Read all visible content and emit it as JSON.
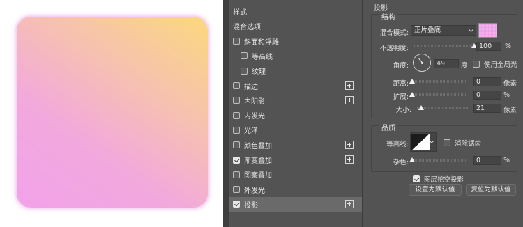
{
  "style_list": {
    "items": [
      {
        "label": "样式",
        "checkbox": false,
        "checked": false,
        "plus": false,
        "selected": false,
        "indent": 0
      },
      {
        "label": "混合选项",
        "checkbox": false,
        "checked": false,
        "plus": false,
        "selected": false,
        "indent": 0
      },
      {
        "label": "斜面和浮雕",
        "checkbox": true,
        "checked": false,
        "plus": false,
        "selected": false,
        "indent": 0
      },
      {
        "label": "等高线",
        "checkbox": true,
        "checked": false,
        "plus": false,
        "selected": false,
        "indent": 1
      },
      {
        "label": "纹理",
        "checkbox": true,
        "checked": false,
        "plus": false,
        "selected": false,
        "indent": 1
      },
      {
        "label": "描边",
        "checkbox": true,
        "checked": false,
        "plus": true,
        "selected": false,
        "indent": 0
      },
      {
        "label": "内阴影",
        "checkbox": true,
        "checked": false,
        "plus": true,
        "selected": false,
        "indent": 0
      },
      {
        "label": "内发光",
        "checkbox": true,
        "checked": false,
        "plus": false,
        "selected": false,
        "indent": 0
      },
      {
        "label": "光泽",
        "checkbox": true,
        "checked": false,
        "plus": false,
        "selected": false,
        "indent": 0
      },
      {
        "label": "颜色叠加",
        "checkbox": true,
        "checked": false,
        "plus": true,
        "selected": false,
        "indent": 0
      },
      {
        "label": "渐变叠加",
        "checkbox": true,
        "checked": true,
        "plus": true,
        "selected": false,
        "indent": 0
      },
      {
        "label": "图案叠加",
        "checkbox": true,
        "checked": false,
        "plus": false,
        "selected": false,
        "indent": 0
      },
      {
        "label": "外发光",
        "checkbox": true,
        "checked": false,
        "plus": false,
        "selected": false,
        "indent": 0
      },
      {
        "label": "投影",
        "checkbox": true,
        "checked": true,
        "plus": true,
        "selected": true,
        "indent": 0
      }
    ]
  },
  "drop_shadow": {
    "title": "投影",
    "structure": {
      "title": "结构",
      "blend_mode_label": "混合模式:",
      "blend_mode_value": "正片叠底",
      "shadow_color": "#ec9ce6",
      "opacity_label": "不透明度:",
      "opacity_value": "100",
      "opacity_unit": "%",
      "opacity_level": 1.0,
      "angle_label": "角度:",
      "angle_value": "49",
      "angle_unit": "度",
      "global_light_label": "使用全局光",
      "global_light_checked": false,
      "distance_label": "距离:",
      "distance_value": "0",
      "distance_unit": "像素",
      "distance_level": 0.0,
      "spread_label": "扩展:",
      "spread_value": "0",
      "spread_unit": "%",
      "spread_level": 0.0,
      "size_label": "大小:",
      "size_value": "21",
      "size_unit": "像素",
      "size_level": 0.08
    },
    "quality": {
      "title": "品质",
      "contour_label": "等高线:",
      "anti_alias_label": "消除锯齿",
      "anti_alias_checked": false,
      "noise_label": "杂色:",
      "noise_value": "0",
      "noise_unit": "%",
      "noise_level": 0.0
    },
    "knockout_label": "图层挖空投影",
    "knockout_checked": true,
    "make_default_label": "设置为默认值",
    "reset_default_label": "复位为默认值"
  },
  "colors": {
    "panel_bg": "#535353",
    "selected_row": "#6a6a6a",
    "preview_gradient_start": "#f2a2ea",
    "preview_gradient_end": "#fcd87e"
  }
}
